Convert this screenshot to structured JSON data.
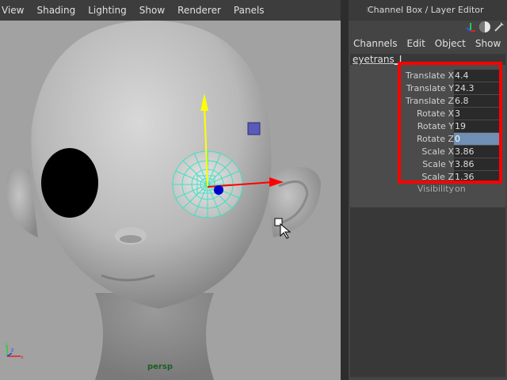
{
  "viewport": {
    "menus": [
      "View",
      "Shading",
      "Lighting",
      "Show",
      "Renderer",
      "Panels"
    ],
    "camera_label": "persp",
    "axis_labels": {
      "y": "y",
      "x": "x",
      "z": "z"
    }
  },
  "panel": {
    "title": "Channel Box / Layer Editor",
    "menus": [
      "Channels",
      "Edit",
      "Object",
      "Show"
    ],
    "object_name": "eyetrans_L",
    "attributes": [
      {
        "label": "Translate X",
        "value": "4.4"
      },
      {
        "label": "Translate Y",
        "value": "24.3"
      },
      {
        "label": "Translate Z",
        "value": "6.8"
      },
      {
        "label": "Rotate X",
        "value": "3"
      },
      {
        "label": "Rotate Y",
        "value": "19"
      },
      {
        "label": "Rotate Z",
        "value": "0"
      },
      {
        "label": "Scale X",
        "value": "3.86"
      },
      {
        "label": "Scale Y",
        "value": "3.86"
      },
      {
        "label": "Scale Z",
        "value": "1.36"
      }
    ],
    "visibility": {
      "label": "Visibility",
      "value": "on"
    }
  },
  "colors": {
    "highlight": "#ff0000",
    "manip_y": "#ffff00",
    "manip_x": "#ff0000",
    "manip_z": "#0000cc",
    "selection_wire": "#40e0c0"
  }
}
